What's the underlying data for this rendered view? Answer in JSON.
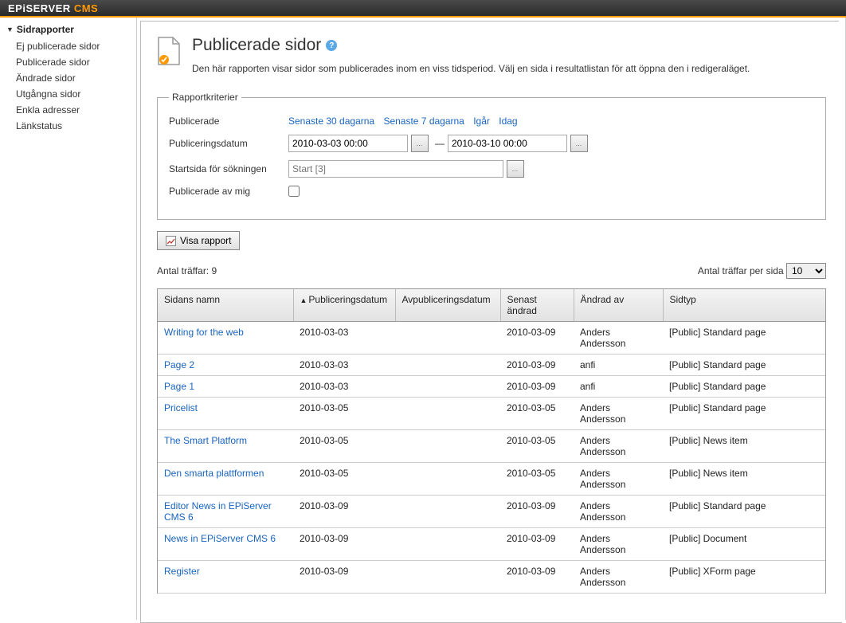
{
  "brand": {
    "prefix": "EPi",
    "name": "SERVER",
    "suffix": " CMS"
  },
  "sidebar": {
    "heading": "Sidrapporter",
    "items": [
      {
        "label": "Ej publicerade sidor"
      },
      {
        "label": "Publicerade sidor"
      },
      {
        "label": "Ändrade sidor"
      },
      {
        "label": "Utgångna sidor"
      },
      {
        "label": "Enkla adresser"
      },
      {
        "label": "Länkstatus"
      }
    ]
  },
  "page": {
    "title": "Publicerade sidor",
    "description": "Den här rapporten visar sidor som publicerades inom en viss tidsperiod. Välj en sida i resultatlistan för att öppna den i redigeraläget."
  },
  "criteria": {
    "legend": "Rapportkriterier",
    "published_label": "Publicerade",
    "links": [
      "Senaste 30 dagarna",
      "Senaste 7 dagarna",
      "Igår",
      "Idag"
    ],
    "date_label": "Publiceringsdatum",
    "date_from": "2010-03-03 00:00",
    "date_to": "2010-03-10 00:00",
    "startpage_label": "Startsida för sökningen",
    "startpage_placeholder": "Start [3]",
    "by_me_label": "Publicerade av mig"
  },
  "buttons": {
    "show_report": "Visa rapport"
  },
  "stats": {
    "hits_prefix": "Antal träffar: ",
    "hits": "9",
    "per_page_label": "Antal träffar per sida",
    "per_page_value": "10"
  },
  "table": {
    "headers": [
      "Sidans namn",
      "Publiceringsdatum",
      "Avpubliceringsdatum",
      "Senast ändrad",
      "Ändrad av",
      "Sidtyp"
    ],
    "rows": [
      {
        "name": "Writing for the web",
        "pub": "2010-03-03",
        "unpub": "",
        "changed": "2010-03-09",
        "by": "Anders Andersson",
        "type": "[Public] Standard page"
      },
      {
        "name": "Page 2",
        "pub": "2010-03-03",
        "unpub": "",
        "changed": "2010-03-09",
        "by": "anfi",
        "type": "[Public] Standard page"
      },
      {
        "name": "Page 1",
        "pub": "2010-03-03",
        "unpub": "",
        "changed": "2010-03-09",
        "by": "anfi",
        "type": "[Public] Standard page"
      },
      {
        "name": "Pricelist",
        "pub": "2010-03-05",
        "unpub": "",
        "changed": "2010-03-05",
        "by": "Anders Andersson",
        "type": "[Public] Standard page"
      },
      {
        "name": "The Smart Platform",
        "pub": "2010-03-05",
        "unpub": "",
        "changed": "2010-03-05",
        "by": "Anders Andersson",
        "type": "[Public] News item"
      },
      {
        "name": "Den smarta plattformen",
        "pub": "2010-03-05",
        "unpub": "",
        "changed": "2010-03-05",
        "by": "Anders Andersson",
        "type": "[Public] News item"
      },
      {
        "name": "Editor News in EPiServer CMS 6",
        "pub": "2010-03-09",
        "unpub": "",
        "changed": "2010-03-09",
        "by": "Anders Andersson",
        "type": "[Public] Standard page"
      },
      {
        "name": "News in EPiServer CMS 6",
        "pub": "2010-03-09",
        "unpub": "",
        "changed": "2010-03-09",
        "by": "Anders Andersson",
        "type": "[Public] Document"
      },
      {
        "name": "Register",
        "pub": "2010-03-09",
        "unpub": "",
        "changed": "2010-03-09",
        "by": "Anders Andersson",
        "type": "[Public] XForm page"
      }
    ]
  }
}
